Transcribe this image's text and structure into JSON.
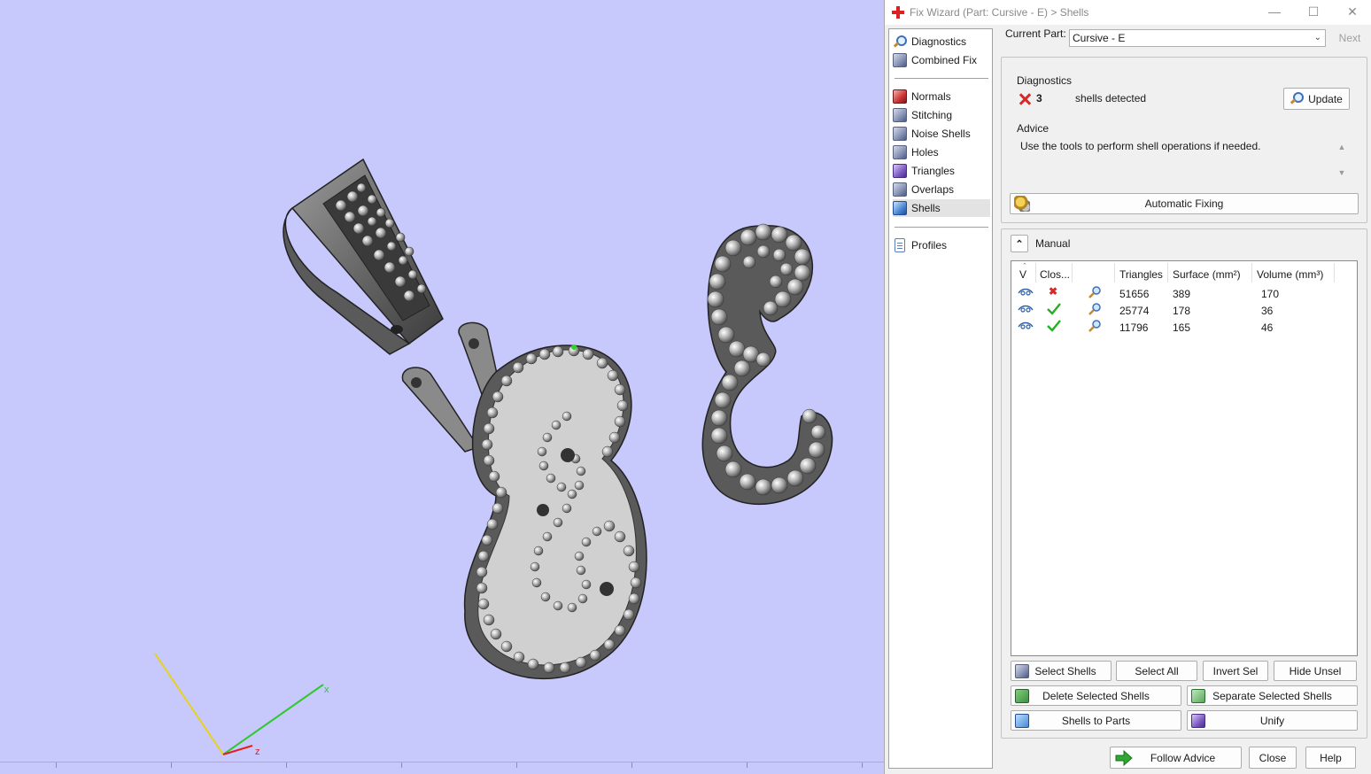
{
  "viewport": {
    "axes": {
      "x_label": "x",
      "z_label": "z"
    }
  },
  "window": {
    "title": "Fix Wizard (Part: Cursive - E) > Shells",
    "minimize_glyph": "—",
    "maximize_glyph": "☐",
    "close_glyph": "✕"
  },
  "nav": {
    "items": [
      {
        "label": "Diagnostics",
        "icon": "diagnostics-icon"
      },
      {
        "label": "Combined Fix",
        "icon": "combined-fix-icon"
      },
      {
        "label": "Normals",
        "icon": "normals-icon"
      },
      {
        "label": "Stitching",
        "icon": "stitching-icon"
      },
      {
        "label": "Noise Shells",
        "icon": "noise-shells-icon"
      },
      {
        "label": "Holes",
        "icon": "holes-icon"
      },
      {
        "label": "Triangles",
        "icon": "triangles-icon"
      },
      {
        "label": "Overlaps",
        "icon": "overlaps-icon"
      },
      {
        "label": "Shells",
        "icon": "shells-icon",
        "selected": true
      },
      {
        "label": "Profiles",
        "icon": "profiles-icon"
      }
    ]
  },
  "current_part": {
    "label": "Current Part:",
    "value": "Cursive - E",
    "next_label": "Next"
  },
  "diagnostics": {
    "group_label": "Diagnostics",
    "count": "3",
    "message": "shells detected",
    "update_label": "Update"
  },
  "advice": {
    "group_label": "Advice",
    "text": "Use the tools to perform shell operations if needed.",
    "auto_fix_label": "Automatic Fixing"
  },
  "manual": {
    "label": "Manual",
    "table": {
      "headers": [
        "V",
        "Clos...",
        "",
        "Triangles",
        "Surface (mm²)",
        "Volume (mm³)"
      ],
      "rows": [
        {
          "closed": false,
          "triangles": "51656",
          "surface": "389",
          "volume": "170"
        },
        {
          "closed": true,
          "triangles": "25774",
          "surface": "178",
          "volume": "36"
        },
        {
          "closed": true,
          "triangles": "11796",
          "surface": "165",
          "volume": "46"
        }
      ]
    },
    "buttons": {
      "select_shells": "Select Shells",
      "select_all": "Select All",
      "invert_sel": "Invert Sel",
      "hide_unsel": "Hide Unsel",
      "delete_selected": "Delete Selected Shells",
      "separate_selected": "Separate Selected Shells",
      "shells_to_parts": "Shells to Parts",
      "unify": "Unify"
    }
  },
  "footer": {
    "follow_advice": "Follow Advice",
    "close": "Close",
    "help": "Help"
  },
  "colors": {
    "viewport_bg": "#c7c8fb",
    "selected_nav": "#e3e3e3",
    "error_red": "#d42a2a",
    "ok_green": "#23b023",
    "follow_arrow": "#2fa82f"
  }
}
